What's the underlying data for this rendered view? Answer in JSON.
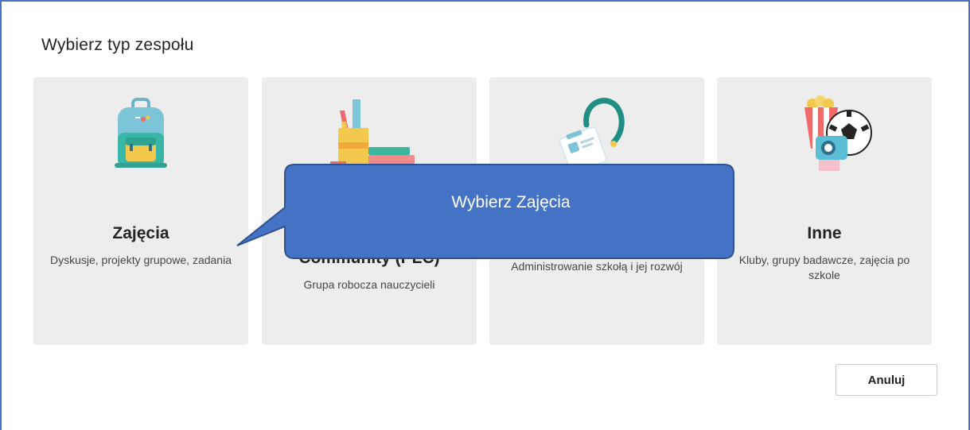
{
  "dialog": {
    "title": "Wybierz typ zespołu",
    "cancel_label": "Anuluj"
  },
  "cards": [
    {
      "name": "Zajęcia",
      "desc": "Dyskusje, projekty grupowe, zadania",
      "icon": "backpack-icon"
    },
    {
      "name": "Professional Learning Community (PLC)",
      "name_visible": "Community (PLC)",
      "desc": "Grupa robocza nauczycieli",
      "icon": "pencil-cup-books-icon"
    },
    {
      "name_visible": "",
      "desc": "Administrowanie szkołą i jej rozwój",
      "icon": "lanyard-badge-icon"
    },
    {
      "name": "Inne",
      "desc": "Kluby, grupy badawcze, zajęcia po szkole",
      "icon": "popcorn-camera-ball-icon"
    }
  ],
  "callout": {
    "text": "Wybierz Zajęcia",
    "color": "#4472c4"
  },
  "colors": {
    "accent": "#4472c4",
    "card_bg": "#ededed"
  }
}
